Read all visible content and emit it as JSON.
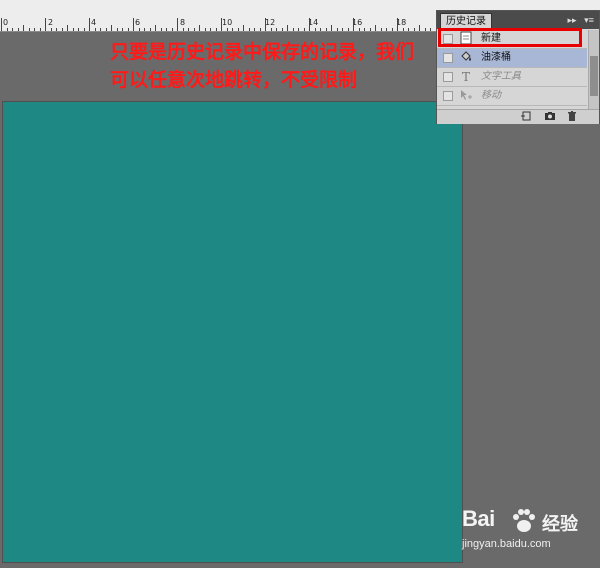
{
  "ruler": {
    "labels": [
      "0",
      "2",
      "4",
      "6",
      "8",
      "10",
      "12",
      "14",
      "16",
      "18"
    ]
  },
  "annotation": {
    "text": "只要是历史记录中保存的记录，我们可以任意次地跳转，不受限制",
    "color": "#ff1a1a"
  },
  "history_panel": {
    "tab_label": "历史记录",
    "collapse_glyph": "▸▸",
    "menu_glyph": "▾≡",
    "items": [
      {
        "label": "新建",
        "icon": "document-icon",
        "state": "normal"
      },
      {
        "label": "油漆桶",
        "icon": "paint-bucket-icon",
        "state": "active"
      },
      {
        "label": "文字工具",
        "icon": "type-tool-icon",
        "state": "dim"
      },
      {
        "label": "移动",
        "icon": "move-tool-icon",
        "state": "dim"
      }
    ],
    "footer_buttons": [
      "new-document-from-state-icon",
      "camera-icon",
      "trash-icon"
    ],
    "highlight_color": "#e80000"
  },
  "canvas": {
    "fill_color": "#1e8884"
  },
  "watermark": {
    "logo": "Bai",
    "logo_suffix": "经验",
    "url": "jingyan.baidu.com"
  }
}
